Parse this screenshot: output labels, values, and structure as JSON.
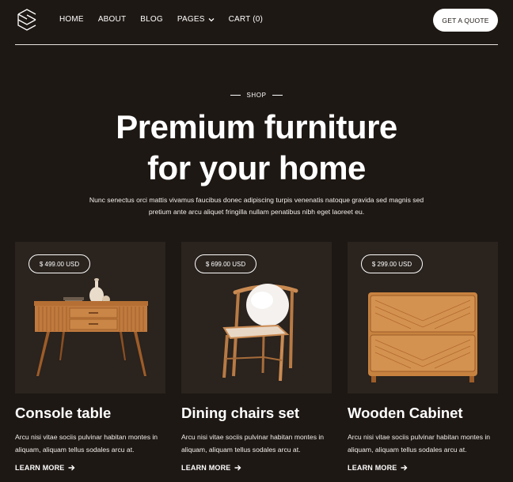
{
  "header": {
    "logo_icon": "cube-outline-icon",
    "nav": [
      {
        "label": "HOME"
      },
      {
        "label": "ABOUT"
      },
      {
        "label": "BLOG"
      },
      {
        "label": "PAGES",
        "has_dropdown": true
      },
      {
        "label": "CART (0)"
      }
    ],
    "cta_label": "GET A QUOTE"
  },
  "hero": {
    "eyebrow": "SHOP",
    "title_line1": "Premium furniture",
    "title_line2": "for your home",
    "text": "Nunc senectus orci mattis vivamus faucibus donec adipiscing turpis venenatis natoque gravida sed magnis sed pretium ante arcu aliquet fringilla nullam penatibus nibh eget laoreet eu."
  },
  "products": [
    {
      "price": "$ 499.00 USD",
      "name": "Console table",
      "description": "Arcu nisi vitae sociis pulvinar habitan montes in aliquam, aliquam tellus sodales arcu at.",
      "link": "LEARN MORE"
    },
    {
      "price": "$ 699.00 USD",
      "name": "Dining chairs set",
      "description": "Arcu nisi vitae sociis pulvinar habitan montes in aliquam, aliquam tellus sodales arcu at.",
      "link": "LEARN MORE"
    },
    {
      "price": "$ 299.00 USD",
      "name": "Wooden Cabinet",
      "description": "Arcu nisi vitae sociis pulvinar habitan montes in aliquam, aliquam tellus sodales arcu at.",
      "link": "LEARN MORE"
    }
  ],
  "colors": {
    "background": "#1e1814",
    "card_background": "#2a231e",
    "wood": "#c07a3e",
    "text": "#ffffff"
  }
}
